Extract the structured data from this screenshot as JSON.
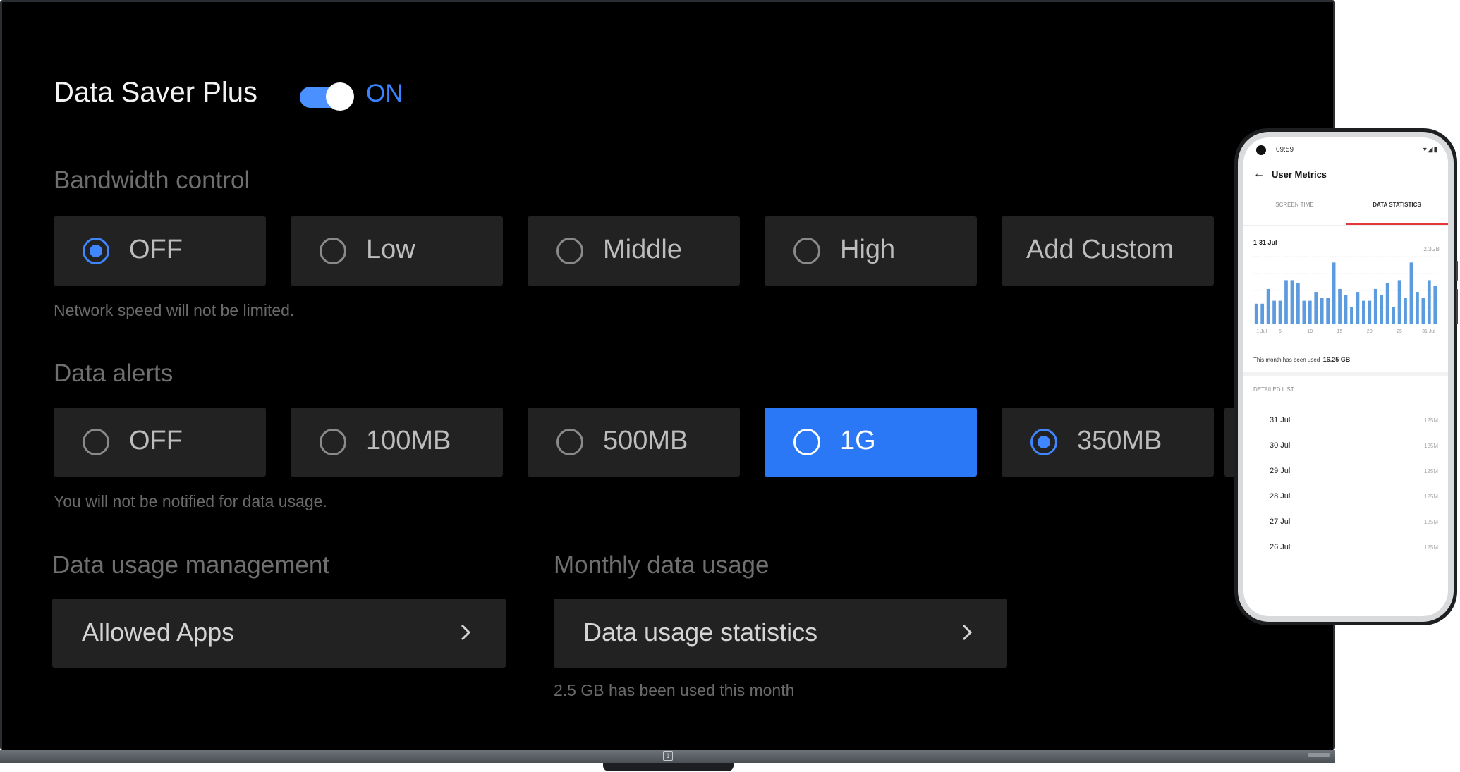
{
  "header": {
    "title": "Data Saver Plus",
    "toggle_state": "ON"
  },
  "bandwidth": {
    "label": "Bandwidth control",
    "options": [
      "OFF",
      "Low",
      "Middle",
      "High",
      "Add Custom"
    ],
    "selected_index": 0,
    "hint": "Network speed will not be limited."
  },
  "alerts": {
    "label": "Data alerts",
    "options": [
      "OFF",
      "100MB",
      "500MB",
      "1G",
      "350MB"
    ],
    "selected_index": 4,
    "focused_index": 3,
    "hint": "You will not be notified for data usage."
  },
  "management": {
    "label": "Data usage management",
    "button": "Allowed Apps"
  },
  "monthly": {
    "label": "Monthly data usage",
    "button": "Data usage statistics",
    "hint": "2.5 GB has been used this month"
  },
  "colors": {
    "accent": "#3a82ff",
    "focus_bg": "#2a78f5",
    "phone_tab_accent": "#e5373b"
  },
  "phone": {
    "time": "09:59",
    "status_icons": "▾◢▮",
    "back": "←",
    "title": "User Metrics",
    "tabs": [
      "SCREEN TIME",
      "DATA STATISTICS"
    ],
    "active_tab": 1,
    "used_text": "This month has been used",
    "used_value": "16.25 GB",
    "list_header": "DETAILED LIST",
    "list": [
      {
        "date": "31 Jul",
        "value": "125M"
      },
      {
        "date": "30 Jul",
        "value": "125M"
      },
      {
        "date": "29 Jul",
        "value": "125M"
      },
      {
        "date": "28 Jul",
        "value": "125M"
      },
      {
        "date": "27 Jul",
        "value": "125M"
      },
      {
        "date": "26 Jul",
        "value": "125M"
      }
    ]
  },
  "chart_data": {
    "type": "bar",
    "title": "1-31 Jul",
    "ymax_label": "2.3GB",
    "x": [
      1,
      2,
      3,
      4,
      5,
      6,
      7,
      8,
      9,
      10,
      11,
      12,
      13,
      14,
      15,
      16,
      17,
      18,
      19,
      20,
      21,
      22,
      23,
      24,
      25,
      26,
      27,
      28,
      29,
      30,
      31
    ],
    "x_ticks": [
      "1 Jul",
      "5",
      "10",
      "15",
      "20",
      "25",
      "31 Jul"
    ],
    "values": [
      0.7,
      0.7,
      1.2,
      0.8,
      0.8,
      1.5,
      1.5,
      1.4,
      0.8,
      0.8,
      1.1,
      0.9,
      0.9,
      2.1,
      1.2,
      1.0,
      0.6,
      1.1,
      0.8,
      0.8,
      1.2,
      1.0,
      1.4,
      0.6,
      1.5,
      0.9,
      2.1,
      1.1,
      0.9,
      1.5,
      1.3
    ],
    "ylim": [
      0,
      2.3
    ],
    "grid": true
  }
}
